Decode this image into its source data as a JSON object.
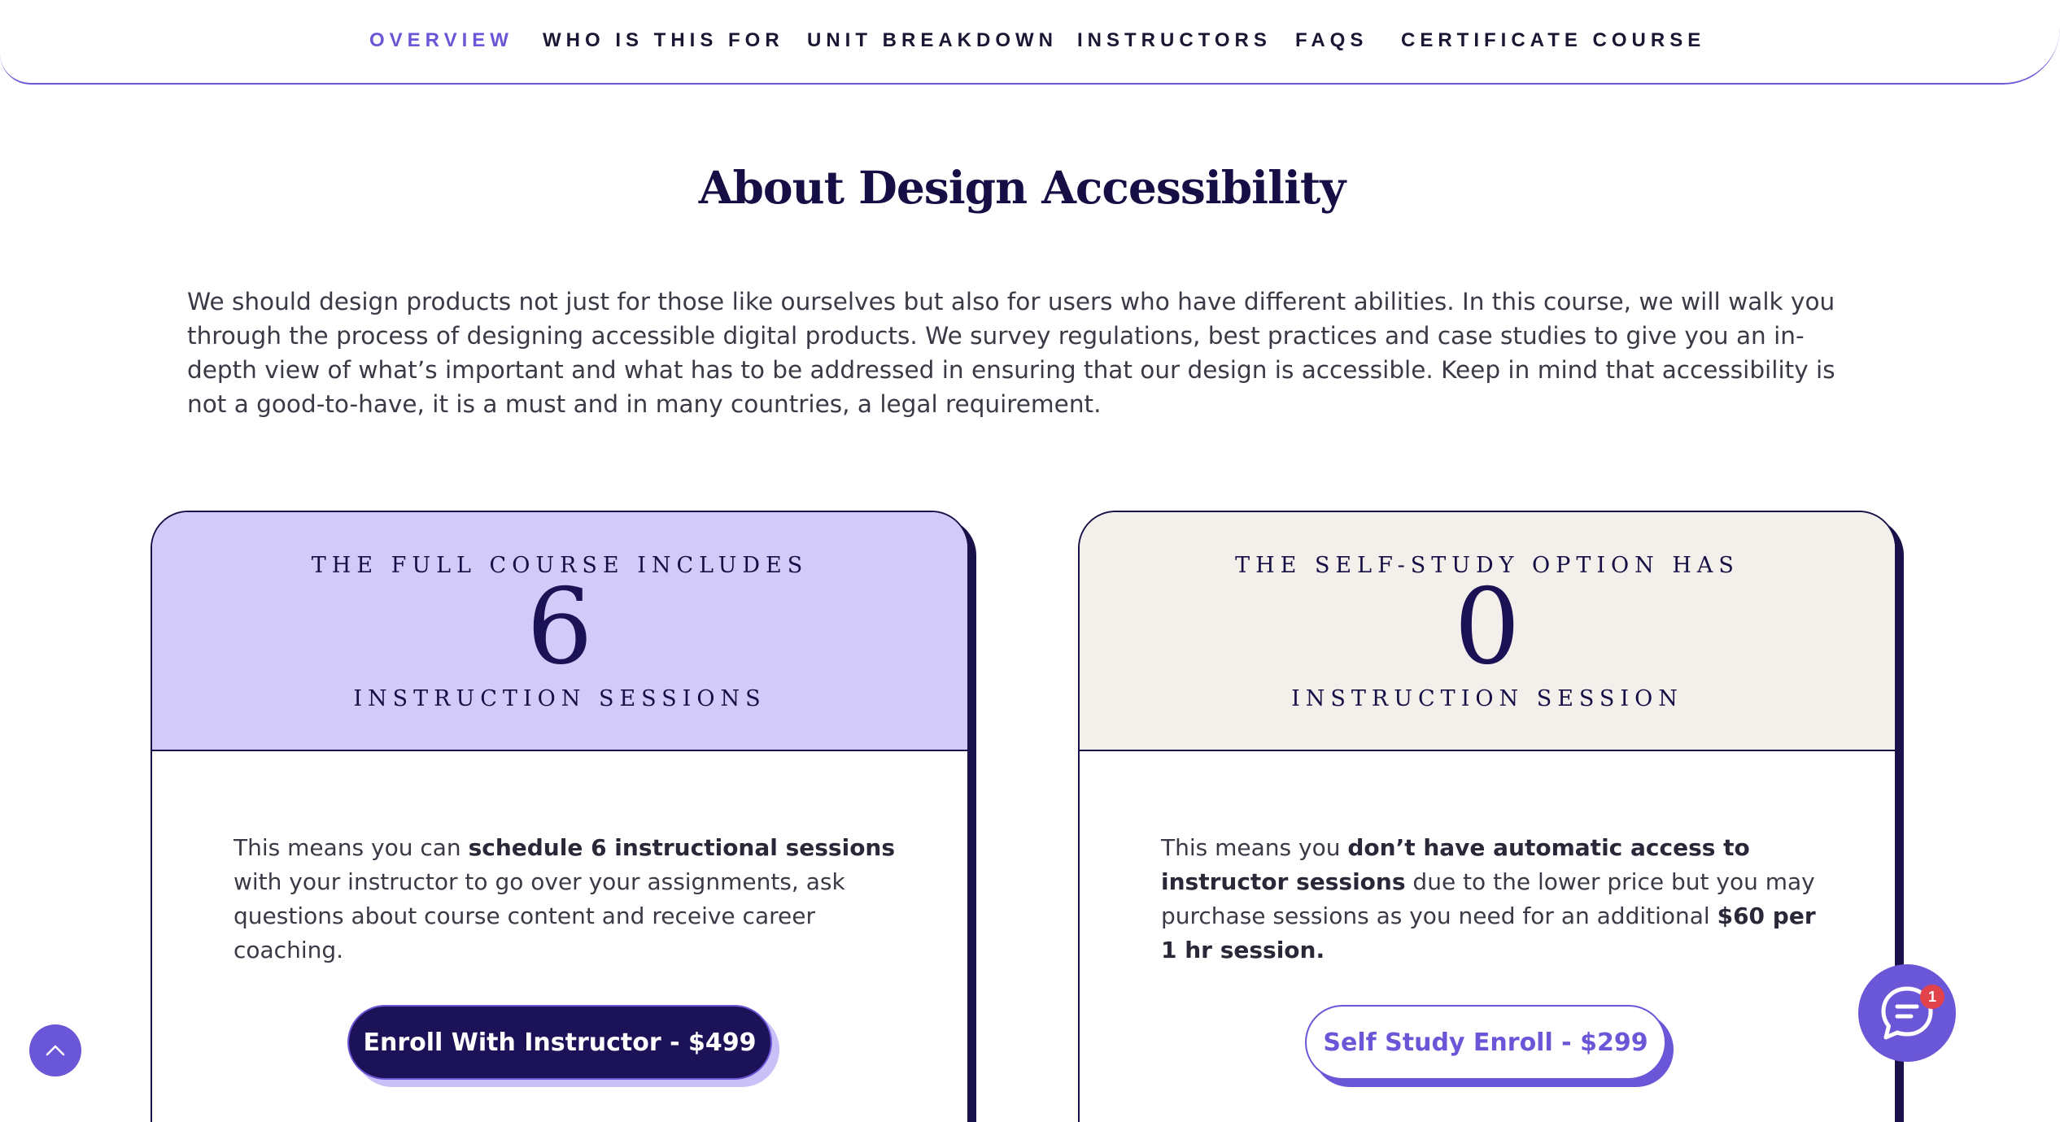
{
  "nav": {
    "items": [
      {
        "label": "OVERVIEW",
        "active": true
      },
      {
        "label": "WHO IS THIS FOR",
        "active": false
      },
      {
        "label": "UNIT BREAKDOWN",
        "active": false
      },
      {
        "label": "INSTRUCTORS",
        "active": false
      },
      {
        "label": "FAQS",
        "active": false
      },
      {
        "label": "CERTIFICATE COURSE",
        "active": false
      }
    ]
  },
  "about": {
    "title": "About Design Accessibility",
    "intro": "We should design products not just for those like ourselves but also for users who have different abilities. In this course, we will walk you through the process of designing accessible digital products. We survey regulations, best practices and case studies to give you an in-depth view of what’s important and what has to be addressed in ensuring that our design is accessible. Keep in mind that accessibility is not a good-to-have, it is a must and in many countries, a legal requirement."
  },
  "cards": [
    {
      "kicker": "THE FULL COURSE INCLUDES",
      "number": "6",
      "sub": "INSTRUCTION SESSIONS",
      "body_1": "This means you can ",
      "body_bold_1": "schedule 6 instructional sessions",
      "body_2": " with your instructor to go over your assignments, ask questions about course content and receive career coaching.",
      "button": "Enroll With Instructor - $499"
    },
    {
      "kicker": "THE SELF-STUDY OPTION HAS",
      "number": "0",
      "sub": "INSTRUCTION SESSION",
      "body_1": "This means you ",
      "body_bold_1": "don’t have automatic access to instructor sessions",
      "body_2": " due to the lower price but you may purchase sessions as you need for an additional ",
      "body_bold_2": "$60 per 1 hr session.",
      "button": "Self Study Enroll - $299"
    }
  ],
  "chat": {
    "badge_count": "1",
    "icon": "chat-bubble-icon"
  },
  "scroll_top": {
    "icon": "chevron-up-icon"
  },
  "colors": {
    "accent": "#6a57d8",
    "navy": "#1c1258",
    "lavender": "#d2cbfa",
    "cream": "#f3efea",
    "badge": "#e2424a"
  }
}
